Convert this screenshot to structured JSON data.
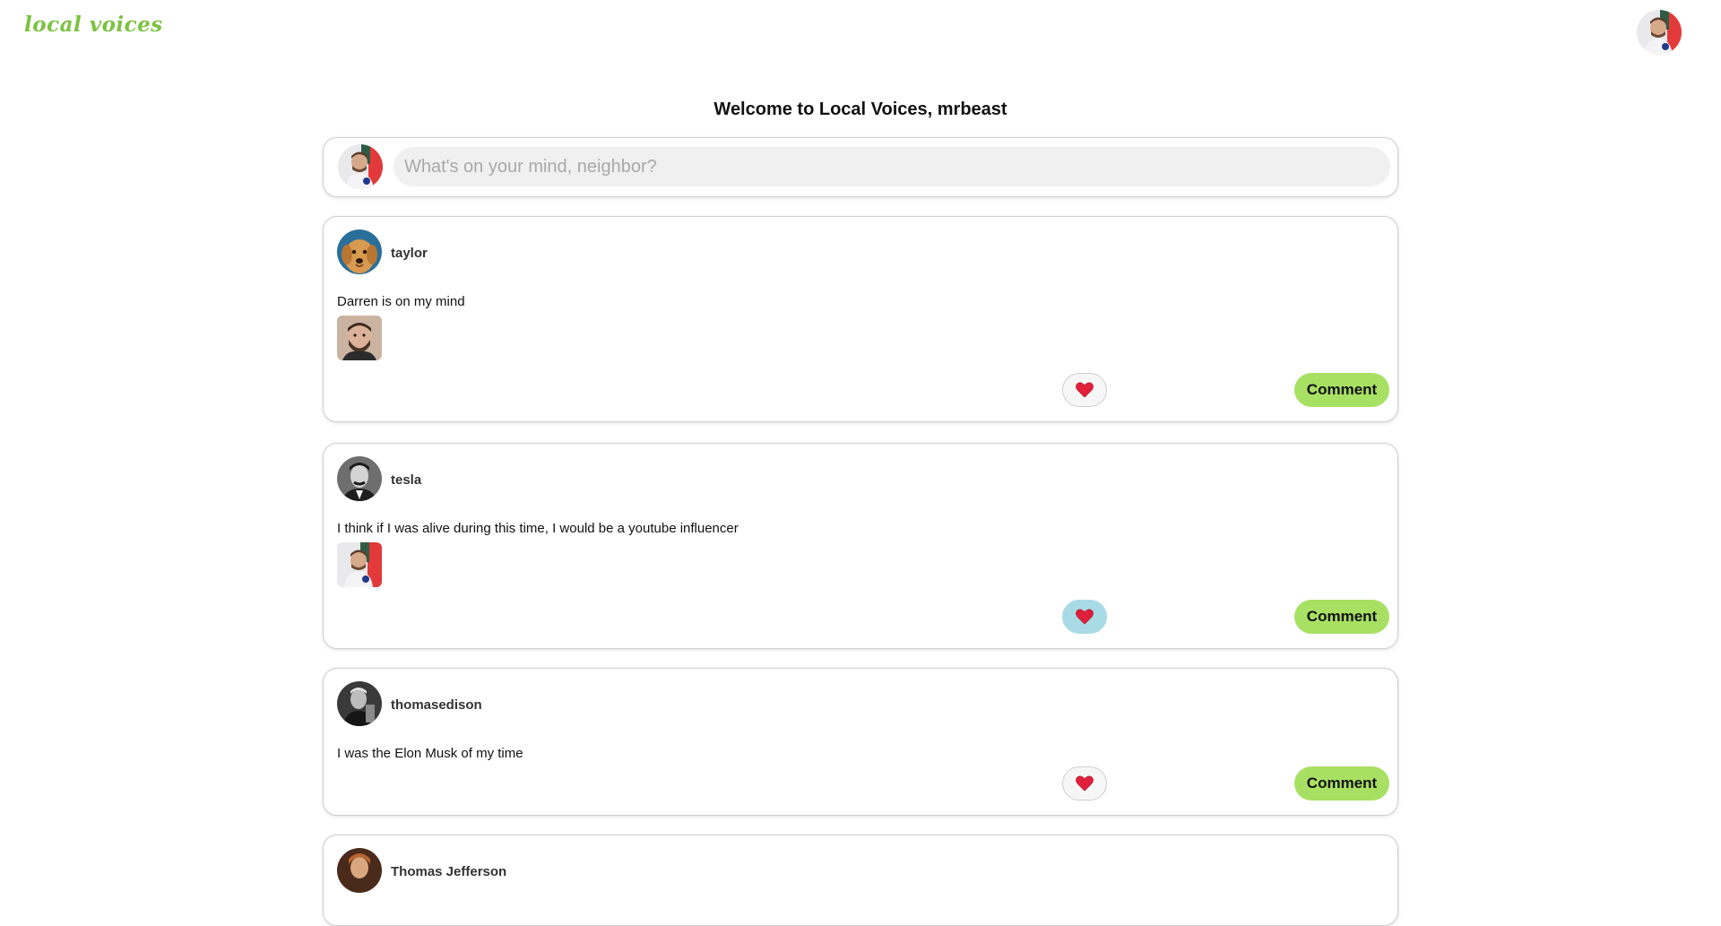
{
  "app": {
    "logo": "local voices"
  },
  "welcome": "Welcome to Local Voices, mrbeast",
  "composer": {
    "placeholder": "What's on your mind, neighbor?"
  },
  "like_icon": "heart-icon",
  "colors": {
    "accent": "#a8e063",
    "logo": "#7cc242",
    "liked": "#a9dbe6",
    "heart": "#e0203a"
  },
  "posts": [
    {
      "username": "taylor",
      "text": "Darren is on my mind",
      "liked": false,
      "comment_label": "Comment"
    },
    {
      "username": "tesla",
      "text": "I think if I was alive during this time, I would be a youtube influencer",
      "liked": true,
      "comment_label": "Comment"
    },
    {
      "username": "thomasedison",
      "text": "I was the Elon Musk of my time",
      "liked": false,
      "comment_label": "Comment"
    },
    {
      "username": "Thomas Jefferson"
    }
  ]
}
